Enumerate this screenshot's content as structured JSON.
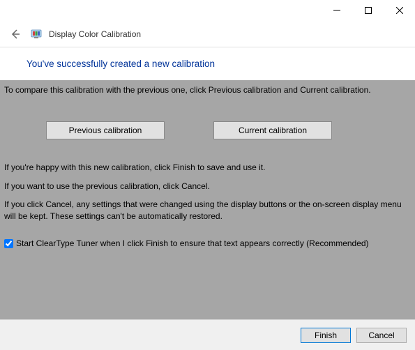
{
  "window": {
    "title": "Display Color Calibration"
  },
  "heading": "You've successfully created a new calibration",
  "body": {
    "compare_text": "To compare this calibration with the previous one, click Previous calibration and Current calibration.",
    "happy_text": "If you're happy with this new calibration, click Finish to save and use it.",
    "previous_text": "If you want to use the previous calibration, click Cancel.",
    "cancel_info_text": "If you click Cancel, any settings that were changed using the display buttons or the on-screen display menu will be kept. These settings can't be automatically restored."
  },
  "buttons": {
    "previous_calibration": "Previous calibration",
    "current_calibration": "Current calibration",
    "finish": "Finish",
    "cancel": "Cancel"
  },
  "checkbox": {
    "label": "Start ClearType Tuner when I click Finish to ensure that text appears correctly (Recommended)",
    "checked": true
  }
}
